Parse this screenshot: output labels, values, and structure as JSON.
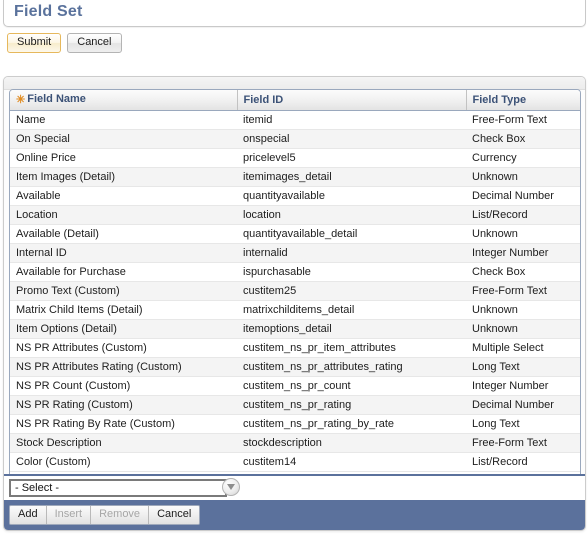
{
  "header": {
    "title": "Field Set"
  },
  "toolbar": {
    "submit_label": "Submit",
    "cancel_label": "Cancel"
  },
  "table": {
    "columns": [
      {
        "key": "field_name",
        "label": "Field Name",
        "required": true,
        "required_marker": "✳"
      },
      {
        "key": "field_id",
        "label": "Field ID",
        "required": false
      },
      {
        "key": "field_type",
        "label": "Field Type",
        "required": false
      }
    ],
    "rows": [
      {
        "field_name": "Name",
        "field_id": "itemid",
        "field_type": "Free-Form Text"
      },
      {
        "field_name": "On Special",
        "field_id": "onspecial",
        "field_type": "Check Box"
      },
      {
        "field_name": "Online Price",
        "field_id": "pricelevel5",
        "field_type": "Currency"
      },
      {
        "field_name": "Item Images (Detail)",
        "field_id": "itemimages_detail",
        "field_type": "Unknown"
      },
      {
        "field_name": "Available",
        "field_id": "quantityavailable",
        "field_type": "Decimal Number"
      },
      {
        "field_name": "Location",
        "field_id": "location",
        "field_type": "List/Record"
      },
      {
        "field_name": "Available (Detail)",
        "field_id": "quantityavailable_detail",
        "field_type": "Unknown"
      },
      {
        "field_name": "Internal ID",
        "field_id": "internalid",
        "field_type": "Integer Number"
      },
      {
        "field_name": "Available for Purchase",
        "field_id": "ispurchasable",
        "field_type": "Check Box"
      },
      {
        "field_name": "Promo Text (Custom)",
        "field_id": "custitem25",
        "field_type": "Free-Form Text"
      },
      {
        "field_name": "Matrix Child Items (Detail)",
        "field_id": "matrixchilditems_detail",
        "field_type": "Unknown"
      },
      {
        "field_name": "Item Options (Detail)",
        "field_id": "itemoptions_detail",
        "field_type": "Unknown"
      },
      {
        "field_name": "NS PR Attributes (Custom)",
        "field_id": "custitem_ns_pr_item_attributes",
        "field_type": "Multiple Select"
      },
      {
        "field_name": "NS PR Attributes Rating (Custom)",
        "field_id": "custitem_ns_pr_attributes_rating",
        "field_type": "Long Text"
      },
      {
        "field_name": "NS PR Count (Custom)",
        "field_id": "custitem_ns_pr_count",
        "field_type": "Integer Number"
      },
      {
        "field_name": "NS PR Rating (Custom)",
        "field_id": "custitem_ns_pr_rating",
        "field_type": "Decimal Number"
      },
      {
        "field_name": "NS PR Rating By Rate (Custom)",
        "field_id": "custitem_ns_pr_rating_by_rate",
        "field_type": "Long Text"
      },
      {
        "field_name": "Stock Description",
        "field_id": "stockdescription",
        "field_type": "Free-Form Text"
      },
      {
        "field_name": "Color (Custom)",
        "field_id": "custitem14",
        "field_type": "List/Record"
      }
    ]
  },
  "editor": {
    "select_value": "- Select -",
    "dropdown_icon": "chevron-down-icon"
  },
  "actionbar": {
    "add_label": "Add",
    "insert_label": "Insert",
    "remove_label": "Remove",
    "cancel_label": "Cancel"
  },
  "colors": {
    "title": "#5a729c",
    "action_bar": "#5b719c",
    "required_star": "#e08a1e",
    "header_text": "#3c5277",
    "submit_border": "#e6b85c"
  }
}
